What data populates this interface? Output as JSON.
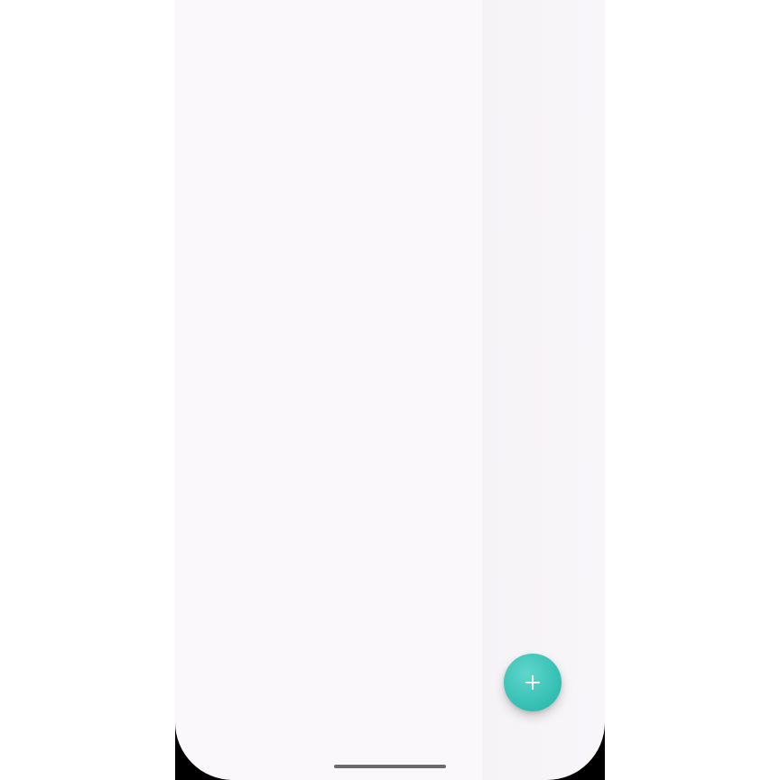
{
  "screen": {
    "background_color": "#fbf8fc",
    "content": []
  },
  "fab": {
    "label": "+",
    "icon": "plus-icon",
    "color_start": "#5fd6cb",
    "color_end": "#1fb3a6"
  },
  "system": {
    "home_indicator_color": "#6b6b6b"
  }
}
